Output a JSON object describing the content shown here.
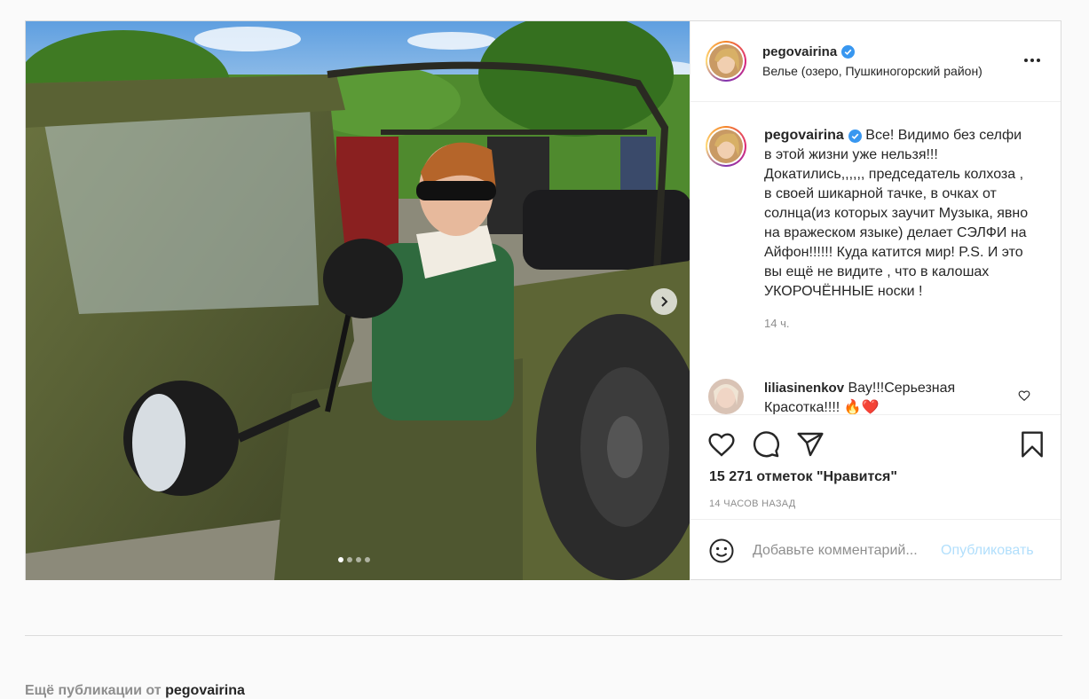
{
  "post": {
    "username": "pegovairina",
    "location": "Велье (озеро, Пушкиногорский район)",
    "caption": "Все! Видимо без селфи в этой жизни уже нельзя!!! Докатились,,,,,, председатель колхоза , в своей шикарной тачке, в очках от солнца(из которых заучит Музыка, явно на вражеском языке) делает СЭЛФИ на Айфон!!!!!! Куда катится мир! P.S. И это вы ещё не видите , что в калошах УКОРОЧЁННЫЕ носки !",
    "caption_time": "14 ч.",
    "likes": "15 271 отметок \"Нравится\"",
    "posted_ago": "14 ЧАСОВ НАЗАД",
    "carousel": {
      "total": 4,
      "active": 1
    }
  },
  "comment": {
    "username": "liliasinenkov",
    "text": "Вау!!!Серьезная Красотка!!!! 🔥❤️"
  },
  "add_comment": {
    "placeholder": "Добавьте комментарий...",
    "publish_label": "Опубликовать"
  },
  "more_posts": {
    "prefix": "Ещё публикации от",
    "username": "pegovairina"
  },
  "icons": [
    "verified-badge-icon",
    "more-options-icon",
    "like-heart-icon",
    "comment-icon",
    "share-icon",
    "save-bookmark-icon",
    "emoji-icon",
    "next-arrow-icon"
  ],
  "colors": {
    "verified": "#3897f0",
    "publish": "#b2dffc",
    "border": "#dbdbdb",
    "muted": "#8e8e8e"
  }
}
